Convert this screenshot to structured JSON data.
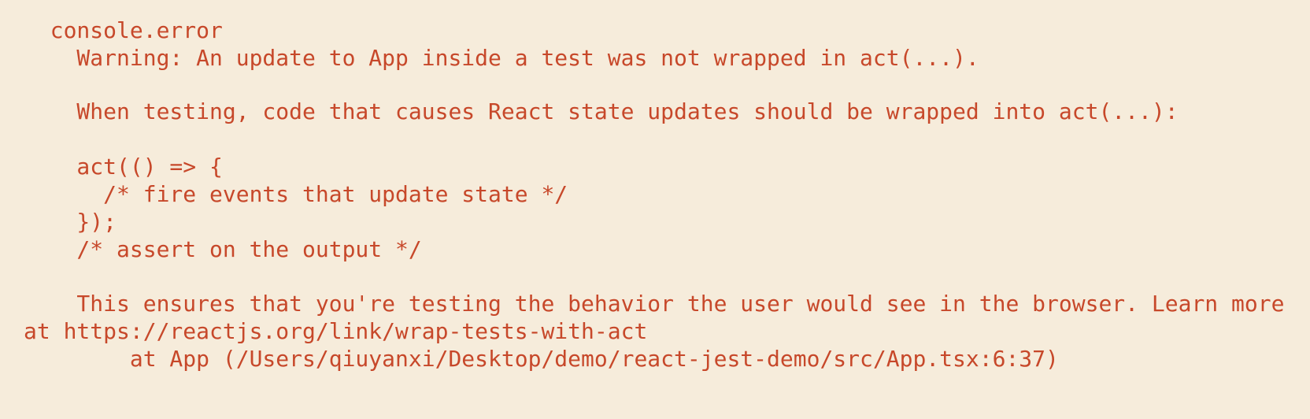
{
  "console": {
    "header": "console.error",
    "warning": "Warning: An update to App inside a test was not wrapped in act(...).",
    "instruction": "When testing, code that causes React state updates should be wrapped into act(...):",
    "code": {
      "line1": "act(() => {",
      "line2": "/* fire events that update state */",
      "line3": "});",
      "line4": "/* assert on the output */"
    },
    "note_line1": "This ensures that you're testing the behavior the user would see in the browser. Learn more",
    "note_line2": "at https://reactjs.org/link/wrap-tests-with-act",
    "stack_trace": "at App (/Users/qiuyanxi/Desktop/demo/react-jest-demo/src/App.tsx:6:37)"
  },
  "colors": {
    "background": "#f6ecdb",
    "text": "#c7482a"
  }
}
